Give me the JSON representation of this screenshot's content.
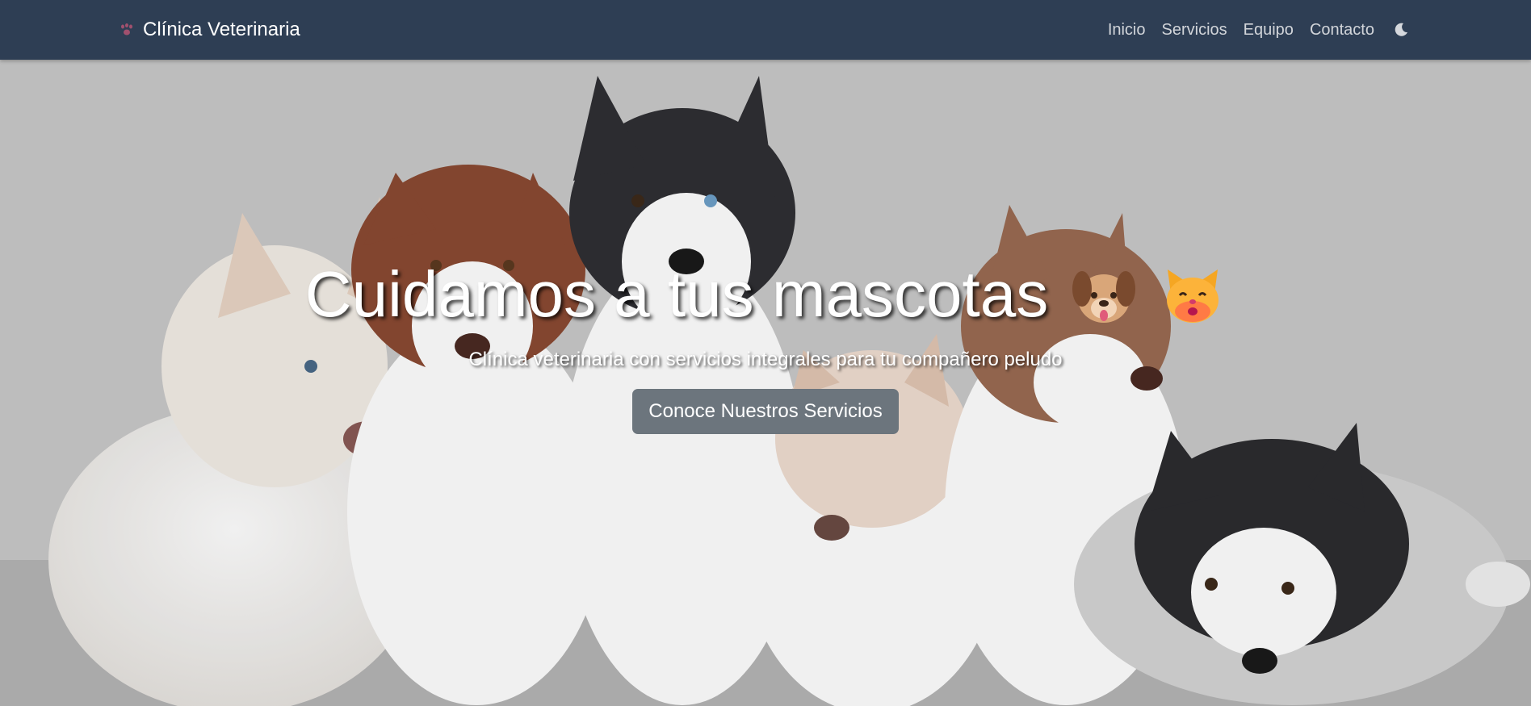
{
  "navbar": {
    "brand": "Clínica Veterinaria",
    "brand_icon": "paw-icon",
    "links": [
      "Inicio",
      "Servicios",
      "Equipo",
      "Contacto"
    ],
    "theme_icon": "moon-icon"
  },
  "hero": {
    "title": "Cuidamos a tus mascotas",
    "title_emojis": [
      "dog-face",
      "cat-face"
    ],
    "subtitle": "Clínica veterinaria con servicios integrales para tu compañero peludo",
    "button": "Conoce Nuestros Servicios",
    "background": "husky-puppies-photo"
  },
  "colors": {
    "navbar_bg": "#2e3e54",
    "button_bg": "#6c757d",
    "text": "#ffffff"
  }
}
